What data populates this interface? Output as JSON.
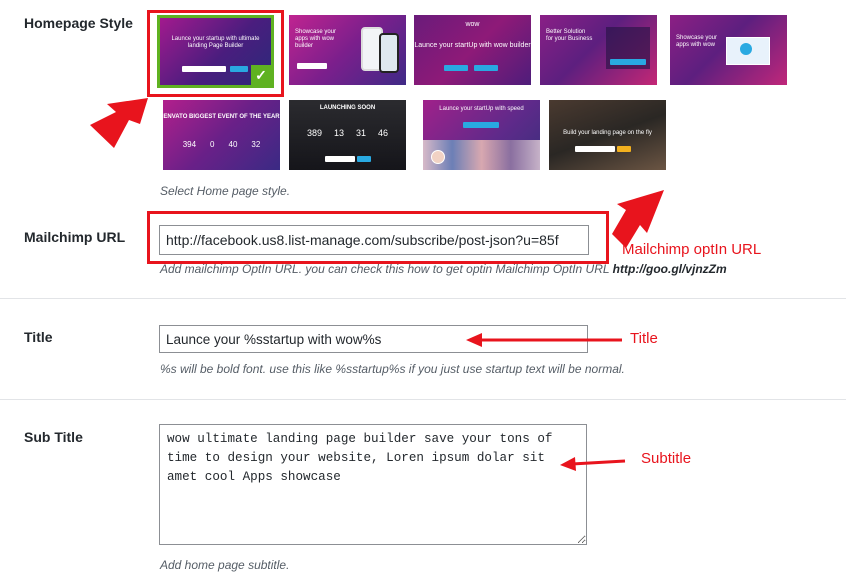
{
  "homepage_style": {
    "label": "Homepage Style",
    "description": "Select Home page style.",
    "thumbnails": [
      {
        "title": "Launce your startup with ultimate landing Page Builder",
        "selected": true
      },
      {
        "title": "Showcase your apps with wow builder",
        "selected": false
      },
      {
        "title": "Launce your startUp with wow builder",
        "selected": false
      },
      {
        "title": "Better Solution for your Business",
        "selected": false
      },
      {
        "title": "Showcase your apps with wow",
        "selected": false
      },
      {
        "title": "ENVATO BIGGEST EVENT OF THE YEAR",
        "counter": [
          "394",
          "0",
          "40",
          "32"
        ],
        "selected": false
      },
      {
        "title": "LAUNCHING SOON",
        "counter": [
          "389",
          "13",
          "31",
          "46"
        ],
        "selected": false
      },
      {
        "title": "Launce your startUp with speed",
        "selected": false
      },
      {
        "title": "Build your landing page on the fly",
        "selected": false
      }
    ],
    "checkmark": "✓"
  },
  "mailchimp": {
    "label": "Mailchimp URL",
    "value": "http://facebook.us8.list-manage.com/subscribe/post-json?u=85f",
    "description": "Add mailchimp OptIn URL. you can check this how to get optin Mailchimp OptIn URL",
    "link": "http://goo.gl/vjnzZm"
  },
  "title": {
    "label": "Title",
    "value": "Launce your %sstartup with wow%s",
    "description": "%s will be bold font. use this like %sstartup%s if you just use startup text will be normal."
  },
  "subtitle": {
    "label": "Sub Title",
    "value": "wow ultimate landing page builder save your tons of time to design your website, Loren ipsum dolar sit amet cool Apps showcase",
    "description": "Add home page subtitle."
  },
  "annotations": {
    "mailchimp": "Mailchimp optIn URL",
    "title": "Title",
    "subtitle": "Subtitle"
  },
  "colors": {
    "annotation_red": "#e8141d",
    "selected_green": "#5fb221",
    "link_blue": "#29a9e1"
  }
}
